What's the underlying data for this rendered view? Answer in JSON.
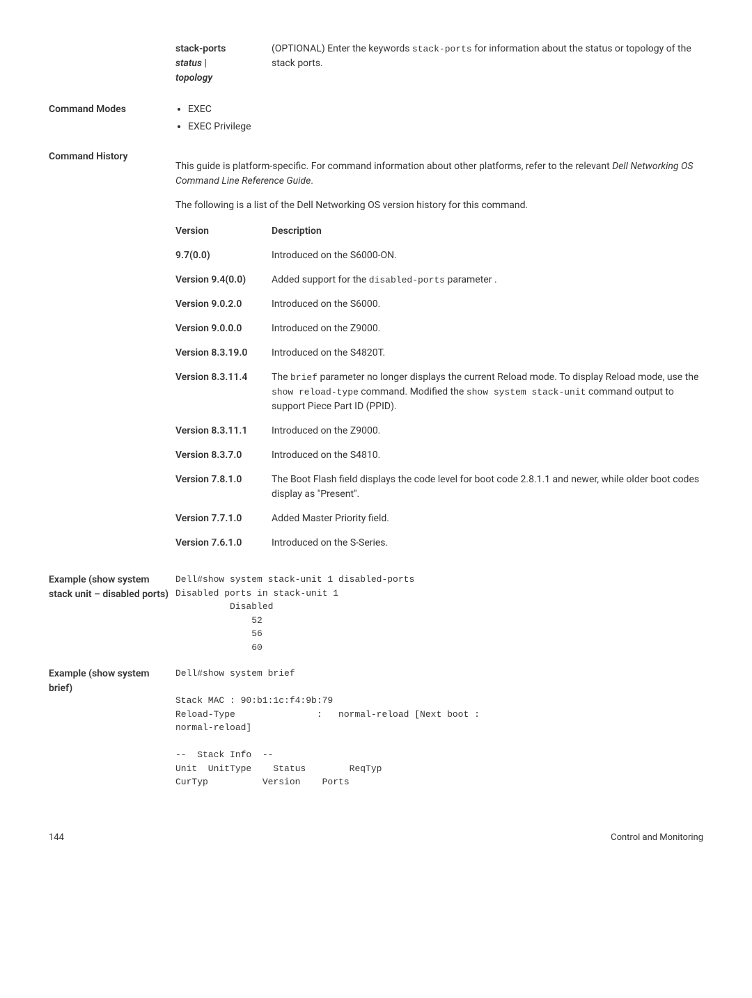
{
  "param": {
    "term1": "stack-ports",
    "term2": "status",
    "term2_sep": " | ",
    "term3": "topology",
    "def_part1": "(OPTIONAL) Enter the keywords ",
    "def_code": "stack-ports",
    "def_part2": " for information about the status or topology of the stack ports."
  },
  "modes": {
    "label": "Command Modes",
    "items": [
      "EXEC",
      "EXEC Privilege"
    ]
  },
  "history": {
    "label": "Command History",
    "intro_part1": "This guide is platform-specific. For command information about other platforms, refer to the relevant ",
    "intro_italic": "Dell Networking OS Command Line Reference Guide",
    "intro_part2": ".",
    "intro2": "The following is a list of the Dell Networking OS version history for this command.",
    "header": {
      "c1": "Version",
      "c2": "Description"
    },
    "rows": [
      {
        "v": "9.7(0.0)",
        "d_parts": [
          {
            "t": "Introduced on the S6000-ON."
          }
        ]
      },
      {
        "v": "Version 9.4(0.0)",
        "d_parts": [
          {
            "t": "Added support for the "
          },
          {
            "c": "disabled-ports"
          },
          {
            "t": " parameter ."
          }
        ]
      },
      {
        "v": "Version 9.0.2.0",
        "d_parts": [
          {
            "t": "Introduced on the S6000."
          }
        ]
      },
      {
        "v": "Version 9.0.0.0",
        "d_parts": [
          {
            "t": "Introduced on the Z9000."
          }
        ]
      },
      {
        "v": "Version 8.3.19.0",
        "d_parts": [
          {
            "t": "Introduced on the S4820T."
          }
        ]
      },
      {
        "v": "Version 8.3.11.4",
        "d_parts": [
          {
            "t": "The "
          },
          {
            "c": "brief"
          },
          {
            "t": " parameter no longer displays the current Reload mode. To display Reload mode, use the "
          },
          {
            "c": "show reload-type"
          },
          {
            "t": " command. Modified the "
          },
          {
            "c": "show system stack-unit"
          },
          {
            "t": " command output to support Piece Part ID (PPID)."
          }
        ]
      },
      {
        "v": "Version 8.3.11.1",
        "d_parts": [
          {
            "t": "Introduced on the Z9000."
          }
        ]
      },
      {
        "v": "Version 8.3.7.0",
        "d_parts": [
          {
            "t": "Introduced on the S4810."
          }
        ]
      },
      {
        "v": "Version 7.8.1.0",
        "d_parts": [
          {
            "t": "The Boot Flash field displays the code level for boot code 2.8.1.1 and newer, while older boot codes display as \"Present\"."
          }
        ]
      },
      {
        "v": "Version 7.7.1.0",
        "d_parts": [
          {
            "t": "Added Master Priority field."
          }
        ]
      },
      {
        "v": "Version 7.6.1.0",
        "d_parts": [
          {
            "t": "Introduced on the S-Series."
          }
        ]
      }
    ]
  },
  "example1": {
    "label": "Example (show system stack unit – disabled ports)",
    "code": "Dell#show system stack-unit 1 disabled-ports\nDisabled ports in stack-unit 1\n          Disabled\n              52\n              56\n              60"
  },
  "example2": {
    "label": "Example (show system brief)",
    "code": "Dell#show system brief\n\nStack MAC : 90:b1:1c:f4:9b:79\nReload-Type               :   normal-reload [Next boot :\nnormal-reload]\n\n--  Stack Info  --\nUnit  UnitType    Status        ReqTyp\nCurTyp          Version    Ports"
  },
  "footer": {
    "left": "144",
    "right": "Control and Monitoring"
  }
}
